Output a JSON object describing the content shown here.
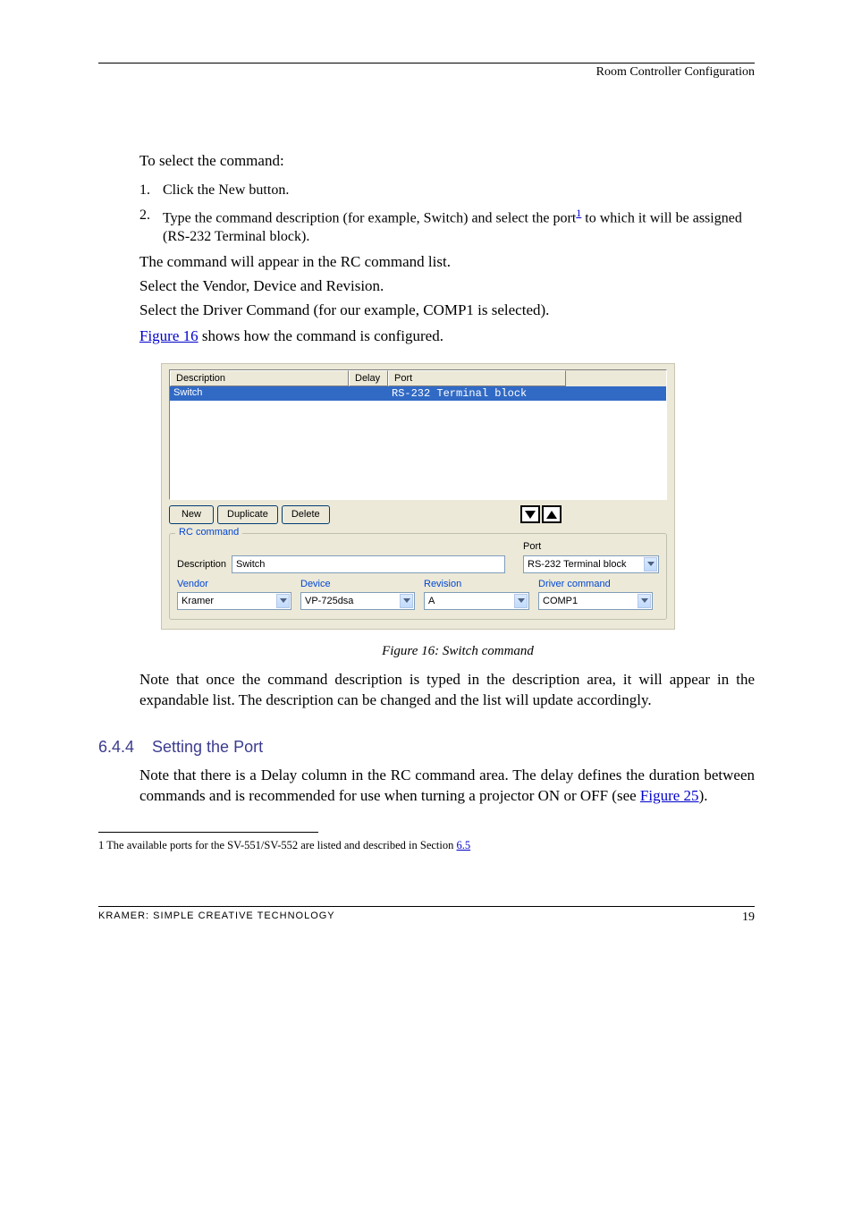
{
  "header": {
    "right": "Room Controller Configuration"
  },
  "paragraphs": {
    "p1": "To select the command:",
    "p2": "The command will appear in the RC command list.",
    "p3": "Select the Vendor, Device and Revision.",
    "p4": "Select the Driver Command (for our example, COMP1 is selected).",
    "p_list1_num": "1.",
    "p_list1_txt": "Click the New button.",
    "p_list2_num": "2.",
    "p_list2_txt": "Type the command description (for example, Switch) and select the port",
    "p_foot_ref": "1",
    "p_list2_cont": " to which it will be assigned (RS-232 Terminal block).",
    "fig16_link": "Figure 16",
    "fig16_rest": " shows how the command is configured.",
    "fig_caption": "Figure 16: Switch command",
    "p5a": "Note that once the command description is typed in the description area, it will appear in the expandable list. The description can be changed and the list will update accordingly.",
    "p5b": "Note that there is a Delay column in the RC command area. The delay defines the duration between commands and is recommended for use when turning a projector ON or OFF (see ",
    "fig25_link": "Figure 25",
    "p5c": ").",
    "footnote_text": " The available ports for the SV-551/SV-552 are listed and described in Section "
  },
  "section": {
    "num": "6.4.4",
    "title": "Setting the Port"
  },
  "ui": {
    "cols": {
      "desc": "Description",
      "delay": "Delay",
      "port": "Port"
    },
    "row": {
      "desc": "Switch",
      "delay": "",
      "port": "RS-232 Terminal block"
    },
    "buttons": {
      "new": "New",
      "dup": "Duplicate",
      "del": "Delete"
    },
    "group_title": "RC command",
    "labels": {
      "description": "Description",
      "port": "Port",
      "vendor": "Vendor",
      "device": "Device",
      "revision": "Revision",
      "driver_cmd": "Driver command"
    },
    "values": {
      "description": "Switch",
      "port": "RS-232 Terminal block",
      "vendor": "Kramer",
      "device": "VP-725dsa",
      "revision": "A",
      "driver_cmd": "COMP1"
    }
  },
  "footnote": {
    "num": "1",
    "link": "6.5"
  },
  "footer": {
    "left": "KRAMER: SIMPLE CREATIVE TECHNOLOGY",
    "right": "19"
  }
}
